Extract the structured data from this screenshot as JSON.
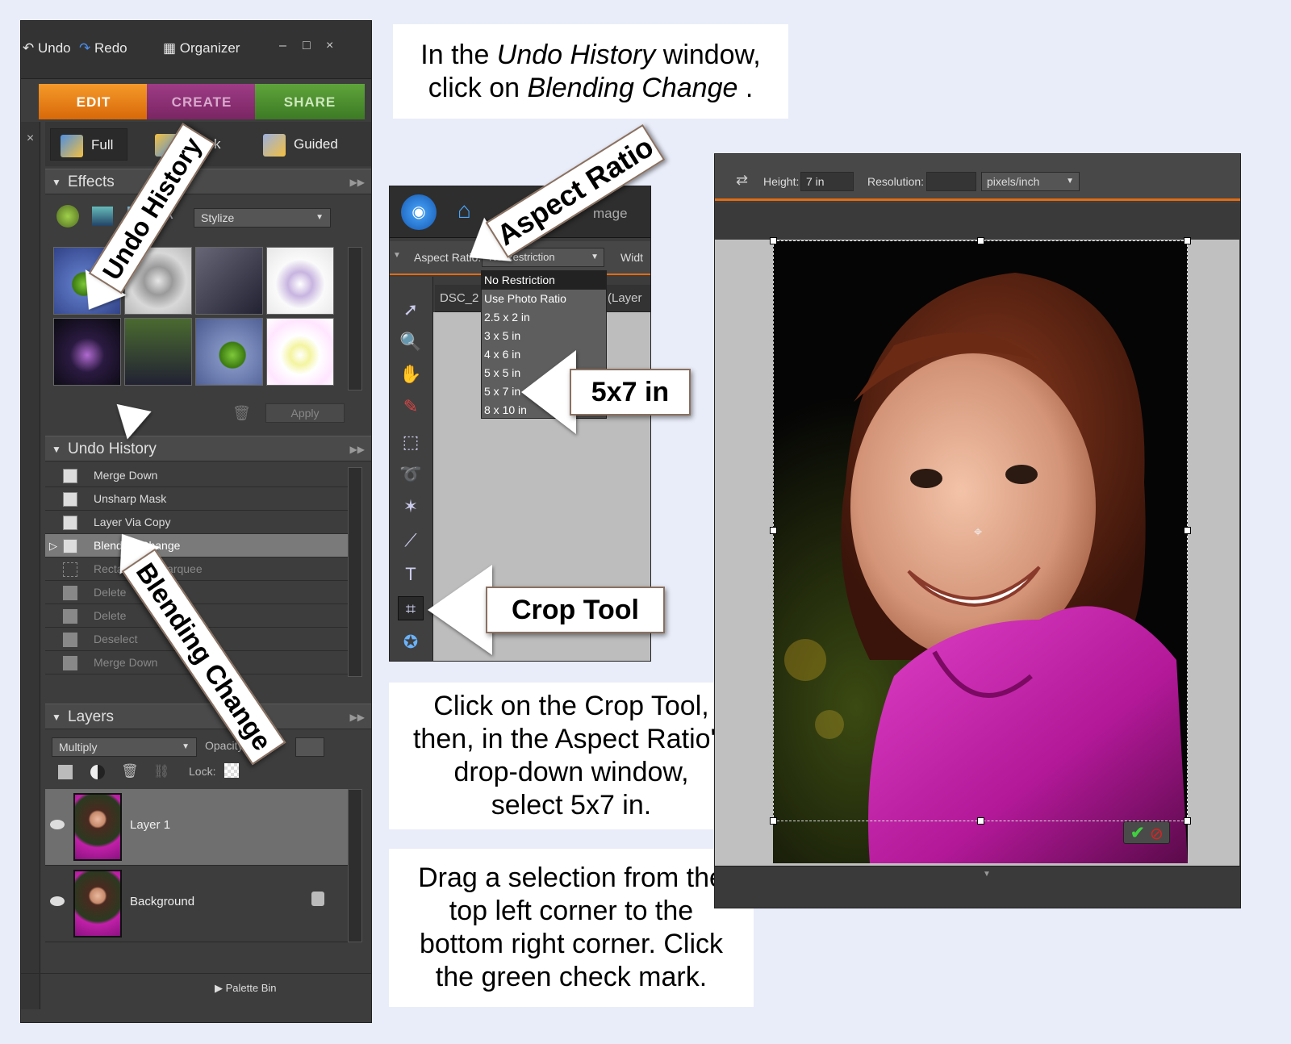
{
  "left_panel": {
    "topbar": {
      "undo": "Undo",
      "redo": "Redo",
      "organizer": "Organizer",
      "minimize": "–",
      "maximize": "□",
      "close": "×"
    },
    "tabs": {
      "edit": "EDIT",
      "create": "CREATE",
      "share": "SHARE"
    },
    "modes": {
      "full": "Full",
      "quick": "Quick",
      "guided": "Guided"
    },
    "effects": {
      "title": "Effects",
      "filter_value": "Stylize",
      "apply_label": "Apply"
    },
    "undo_history": {
      "title": "Undo History",
      "items": [
        {
          "label": "Merge Down",
          "state": "active"
        },
        {
          "label": "Unsharp Mask",
          "state": "active"
        },
        {
          "label": "Layer Via Copy",
          "state": "active"
        },
        {
          "label": "Blending Change",
          "state": "selected"
        },
        {
          "label": "Rectangular Marquee",
          "state": "dim"
        },
        {
          "label": "Delete",
          "state": "dim"
        },
        {
          "label": "Delete",
          "state": "dim"
        },
        {
          "label": "Deselect",
          "state": "dim"
        },
        {
          "label": "Merge Down",
          "state": "dim"
        }
      ]
    },
    "layers": {
      "title": "Layers",
      "blend_mode": "Multiply",
      "opacity_label": "Opacity:",
      "lock_label": "Lock:",
      "items": [
        {
          "name": "Layer 1"
        },
        {
          "name": "Background"
        }
      ]
    },
    "palette_bin": "Palette Bin"
  },
  "callouts": {
    "undo_history": "Undo History",
    "blending_change": "Blending Change",
    "aspect_ratio": "Aspect Ratio",
    "five_by_seven": "5x7 in",
    "crop_tool": "Crop Tool"
  },
  "notes": {
    "note1_a": "In the ",
    "note1_b": "Undo History",
    "note1_c": " window,",
    "note1_d": "click on ",
    "note1_e": "Blending Change",
    "note1_f": " .",
    "note2": [
      "Click on the Crop Tool,",
      "then, in the Aspect Ratio's",
      "drop-down window,",
      "select 5x7 in."
    ],
    "note3": [
      "Drag a selection from the",
      "top left corner to the",
      "bottom right corner.  Click",
      "the green check mark."
    ]
  },
  "mid_panel": {
    "image_label": "mage",
    "aspect_ratio_label": "Aspect Ratio:",
    "aspect_ratio_value": "No Restriction",
    "width_label": "Widt",
    "doc_tab": "DSC_2",
    "doc_tab_suffix": "(Layer",
    "aspect_options": [
      "No Restriction",
      "Use Photo Ratio",
      "2.5 x 2 in",
      "3 x 5 in",
      "4 x 6 in",
      "5 x 5 in",
      "5 x 7 in",
      "8 x 10 in"
    ]
  },
  "right_panel": {
    "height_label": "Height:",
    "height_value": "7 in",
    "resolution_label": "Resolution:",
    "units_value": "pixels/inch"
  },
  "colors": {
    "edit_tab": "#e8780f",
    "create_tab": "#8b2f73",
    "share_tab": "#4a8a2e",
    "accent": "#e46c12",
    "shirt": "#c020a8"
  }
}
